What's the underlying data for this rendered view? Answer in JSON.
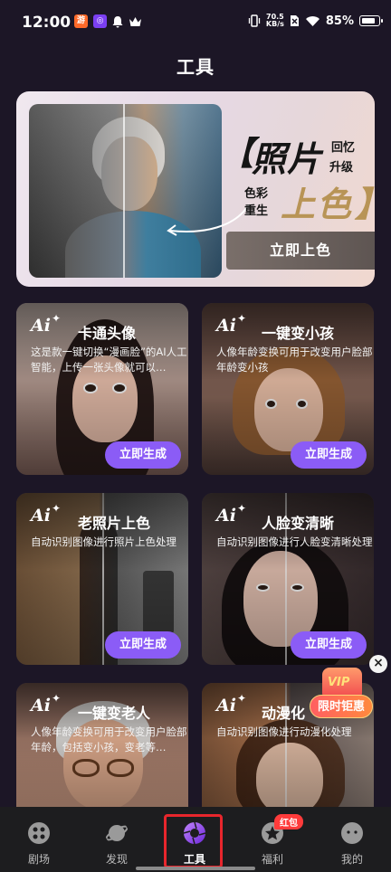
{
  "status_bar": {
    "time": "12:00",
    "net_speed_value": "70.5",
    "net_speed_unit": "KB/s",
    "battery": "85%",
    "battery_level": 0.85
  },
  "page": {
    "title": "工具"
  },
  "hero": {
    "bracket_open": "【",
    "title": "照片",
    "subtitle_line1": "回忆",
    "subtitle_line2": "升级",
    "tag_line1": "色彩",
    "tag_line2": "重生",
    "colorize_text": "上色",
    "bracket_close": "】",
    "button_label": "立即上色"
  },
  "cards": [
    {
      "ai_label": "Ai",
      "title": "卡通头像",
      "description": "这是款一键切换“漫画脸”的AI人工智能，上传一张头像就可以…",
      "button_label": "立即生成"
    },
    {
      "ai_label": "Ai",
      "title": "一键变小孩",
      "description": "人像年龄变换可用于改变用户脸部年龄变小孩",
      "button_label": "立即生成"
    },
    {
      "ai_label": "Ai",
      "title": "老照片上色",
      "description": "自动识别图像进行照片上色处理",
      "button_label": "立即生成"
    },
    {
      "ai_label": "Ai",
      "title": "人脸变清晰",
      "description": "自动识别图像进行人脸变清晰处理",
      "button_label": "立即生成"
    },
    {
      "ai_label": "Ai",
      "title": "一键变老人",
      "description": "人像年龄变换可用于改变用户脸部年龄，包括变小孩，变老等…",
      "button_label": ""
    },
    {
      "ai_label": "Ai",
      "title": "动漫化",
      "description": "自动识别图像进行动漫化处理",
      "button_label": ""
    }
  ],
  "vip_float": {
    "badge": "VIP",
    "label": "限时钜惠",
    "close": "×"
  },
  "bottom_nav": {
    "items": [
      {
        "label": "剧场",
        "icon": "theater-icon"
      },
      {
        "label": "发现",
        "icon": "planet-icon"
      },
      {
        "label": "工具",
        "icon": "camera-aperture-icon",
        "active": true
      },
      {
        "label": "福利",
        "icon": "star-gift-icon"
      },
      {
        "label": "我的",
        "icon": "profile-face-icon"
      }
    ],
    "welfare_badge": "红包"
  },
  "colors": {
    "background": "#1c1626",
    "accent_purple": "#8b5cf6",
    "nav_highlight": "#e8262c"
  }
}
